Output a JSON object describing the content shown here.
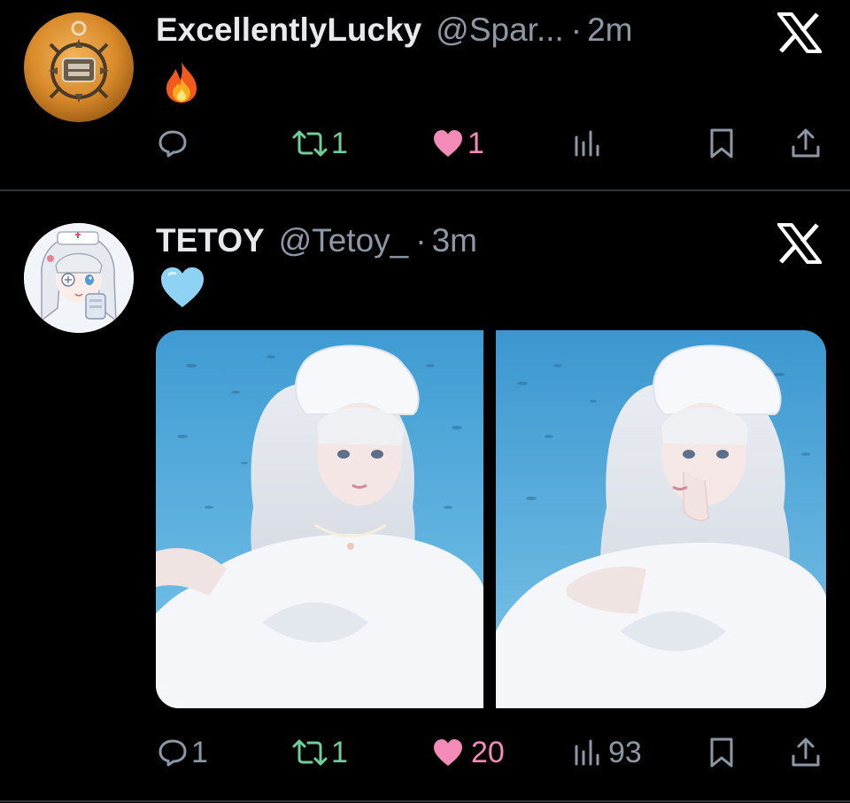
{
  "tweets": [
    {
      "display_name": "ExcellentlyLucky",
      "handle": "@Spar...",
      "separator": "·",
      "time": "2m",
      "emoji": "🔥",
      "avatar_icon": "gold-medallion-avatar",
      "stats": {
        "reply": "",
        "retweet": "1",
        "like": "1",
        "views": ""
      },
      "liked": true
    },
    {
      "display_name": "TETOY",
      "handle": "@Tetoy_",
      "separator": "·",
      "time": "3m",
      "emoji": "🩵",
      "avatar_icon": "anime-nurse-avatar",
      "stats": {
        "reply": "1",
        "retweet": "1",
        "like": "20",
        "views": "93"
      },
      "liked": true,
      "media": [
        {
          "name": "photo-1",
          "description_icon": "underwater-white-lolita-portrait"
        },
        {
          "name": "photo-2",
          "description_icon": "underwater-white-lolita-portrait-finger-pose"
        }
      ]
    }
  ],
  "colors": {
    "background": "#000000",
    "text": "#e7e9ea",
    "secondary": "#8b98a5",
    "retweet_green": "#6fcf97",
    "like_pink": "#f38ab7",
    "divider": "#2f3336"
  }
}
